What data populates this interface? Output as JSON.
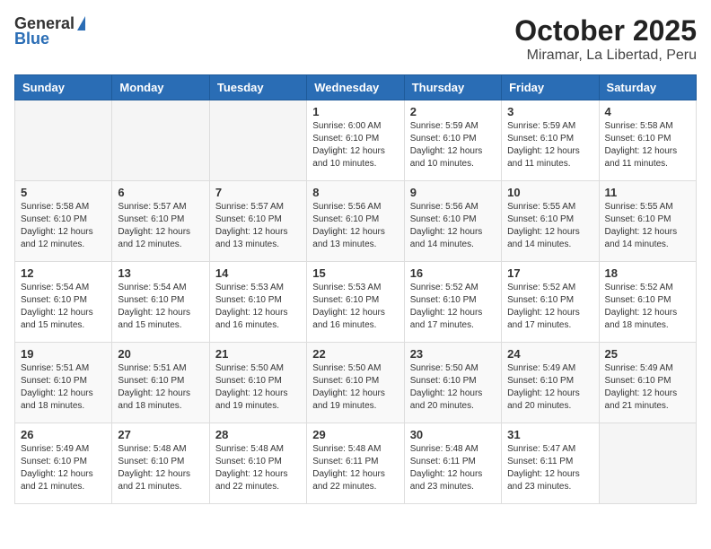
{
  "header": {
    "logo_general": "General",
    "logo_blue": "Blue",
    "title": "October 2025",
    "subtitle": "Miramar, La Libertad, Peru"
  },
  "calendar": {
    "days_of_week": [
      "Sunday",
      "Monday",
      "Tuesday",
      "Wednesday",
      "Thursday",
      "Friday",
      "Saturday"
    ],
    "weeks": [
      [
        {
          "day": "",
          "info": ""
        },
        {
          "day": "",
          "info": ""
        },
        {
          "day": "",
          "info": ""
        },
        {
          "day": "1",
          "info": "Sunrise: 6:00 AM\nSunset: 6:10 PM\nDaylight: 12 hours\nand 10 minutes."
        },
        {
          "day": "2",
          "info": "Sunrise: 5:59 AM\nSunset: 6:10 PM\nDaylight: 12 hours\nand 10 minutes."
        },
        {
          "day": "3",
          "info": "Sunrise: 5:59 AM\nSunset: 6:10 PM\nDaylight: 12 hours\nand 11 minutes."
        },
        {
          "day": "4",
          "info": "Sunrise: 5:58 AM\nSunset: 6:10 PM\nDaylight: 12 hours\nand 11 minutes."
        }
      ],
      [
        {
          "day": "5",
          "info": "Sunrise: 5:58 AM\nSunset: 6:10 PM\nDaylight: 12 hours\nand 12 minutes."
        },
        {
          "day": "6",
          "info": "Sunrise: 5:57 AM\nSunset: 6:10 PM\nDaylight: 12 hours\nand 12 minutes."
        },
        {
          "day": "7",
          "info": "Sunrise: 5:57 AM\nSunset: 6:10 PM\nDaylight: 12 hours\nand 13 minutes."
        },
        {
          "day": "8",
          "info": "Sunrise: 5:56 AM\nSunset: 6:10 PM\nDaylight: 12 hours\nand 13 minutes."
        },
        {
          "day": "9",
          "info": "Sunrise: 5:56 AM\nSunset: 6:10 PM\nDaylight: 12 hours\nand 14 minutes."
        },
        {
          "day": "10",
          "info": "Sunrise: 5:55 AM\nSunset: 6:10 PM\nDaylight: 12 hours\nand 14 minutes."
        },
        {
          "day": "11",
          "info": "Sunrise: 5:55 AM\nSunset: 6:10 PM\nDaylight: 12 hours\nand 14 minutes."
        }
      ],
      [
        {
          "day": "12",
          "info": "Sunrise: 5:54 AM\nSunset: 6:10 PM\nDaylight: 12 hours\nand 15 minutes."
        },
        {
          "day": "13",
          "info": "Sunrise: 5:54 AM\nSunset: 6:10 PM\nDaylight: 12 hours\nand 15 minutes."
        },
        {
          "day": "14",
          "info": "Sunrise: 5:53 AM\nSunset: 6:10 PM\nDaylight: 12 hours\nand 16 minutes."
        },
        {
          "day": "15",
          "info": "Sunrise: 5:53 AM\nSunset: 6:10 PM\nDaylight: 12 hours\nand 16 minutes."
        },
        {
          "day": "16",
          "info": "Sunrise: 5:52 AM\nSunset: 6:10 PM\nDaylight: 12 hours\nand 17 minutes."
        },
        {
          "day": "17",
          "info": "Sunrise: 5:52 AM\nSunset: 6:10 PM\nDaylight: 12 hours\nand 17 minutes."
        },
        {
          "day": "18",
          "info": "Sunrise: 5:52 AM\nSunset: 6:10 PM\nDaylight: 12 hours\nand 18 minutes."
        }
      ],
      [
        {
          "day": "19",
          "info": "Sunrise: 5:51 AM\nSunset: 6:10 PM\nDaylight: 12 hours\nand 18 minutes."
        },
        {
          "day": "20",
          "info": "Sunrise: 5:51 AM\nSunset: 6:10 PM\nDaylight: 12 hours\nand 18 minutes."
        },
        {
          "day": "21",
          "info": "Sunrise: 5:50 AM\nSunset: 6:10 PM\nDaylight: 12 hours\nand 19 minutes."
        },
        {
          "day": "22",
          "info": "Sunrise: 5:50 AM\nSunset: 6:10 PM\nDaylight: 12 hours\nand 19 minutes."
        },
        {
          "day": "23",
          "info": "Sunrise: 5:50 AM\nSunset: 6:10 PM\nDaylight: 12 hours\nand 20 minutes."
        },
        {
          "day": "24",
          "info": "Sunrise: 5:49 AM\nSunset: 6:10 PM\nDaylight: 12 hours\nand 20 minutes."
        },
        {
          "day": "25",
          "info": "Sunrise: 5:49 AM\nSunset: 6:10 PM\nDaylight: 12 hours\nand 21 minutes."
        }
      ],
      [
        {
          "day": "26",
          "info": "Sunrise: 5:49 AM\nSunset: 6:10 PM\nDaylight: 12 hours\nand 21 minutes."
        },
        {
          "day": "27",
          "info": "Sunrise: 5:48 AM\nSunset: 6:10 PM\nDaylight: 12 hours\nand 21 minutes."
        },
        {
          "day": "28",
          "info": "Sunrise: 5:48 AM\nSunset: 6:10 PM\nDaylight: 12 hours\nand 22 minutes."
        },
        {
          "day": "29",
          "info": "Sunrise: 5:48 AM\nSunset: 6:11 PM\nDaylight: 12 hours\nand 22 minutes."
        },
        {
          "day": "30",
          "info": "Sunrise: 5:48 AM\nSunset: 6:11 PM\nDaylight: 12 hours\nand 23 minutes."
        },
        {
          "day": "31",
          "info": "Sunrise: 5:47 AM\nSunset: 6:11 PM\nDaylight: 12 hours\nand 23 minutes."
        },
        {
          "day": "",
          "info": ""
        }
      ]
    ]
  }
}
